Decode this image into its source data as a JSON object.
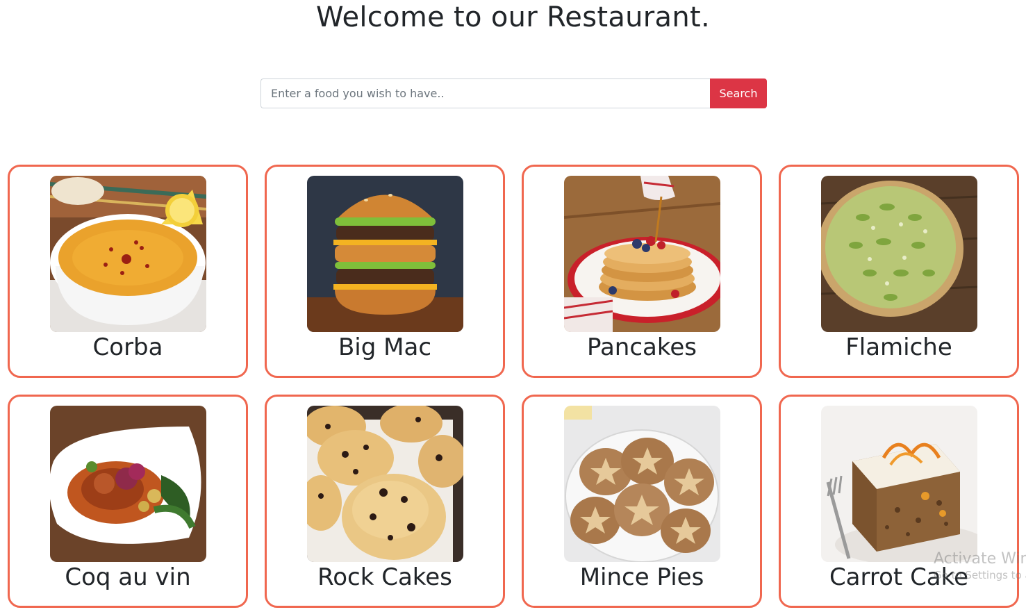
{
  "header": {
    "title": "Welcome to our Restaurant."
  },
  "search": {
    "placeholder": "Enter a food you wish to have..",
    "value": "",
    "button_label": "Search"
  },
  "foods": [
    {
      "name": "Corba",
      "image": "soup-bowl-image"
    },
    {
      "name": "Big Mac",
      "image": "burger-image"
    },
    {
      "name": "Pancakes",
      "image": "pancake-stack-image"
    },
    {
      "name": "Flamiche",
      "image": "leek-tart-image"
    },
    {
      "name": "Coq au vin",
      "image": "chicken-plate-image"
    },
    {
      "name": "Rock Cakes",
      "image": "rock-cakes-image"
    },
    {
      "name": "Mince Pies",
      "image": "mince-pies-image"
    },
    {
      "name": "Carrot Cake",
      "image": "carrot-cake-image"
    }
  ],
  "watermark": {
    "title": "Activate Windows",
    "subtitle": "Go to Settings to activate Windows."
  },
  "colors": {
    "card_border": "#f0674f",
    "search_button": "#dc3545",
    "text": "#212529"
  }
}
